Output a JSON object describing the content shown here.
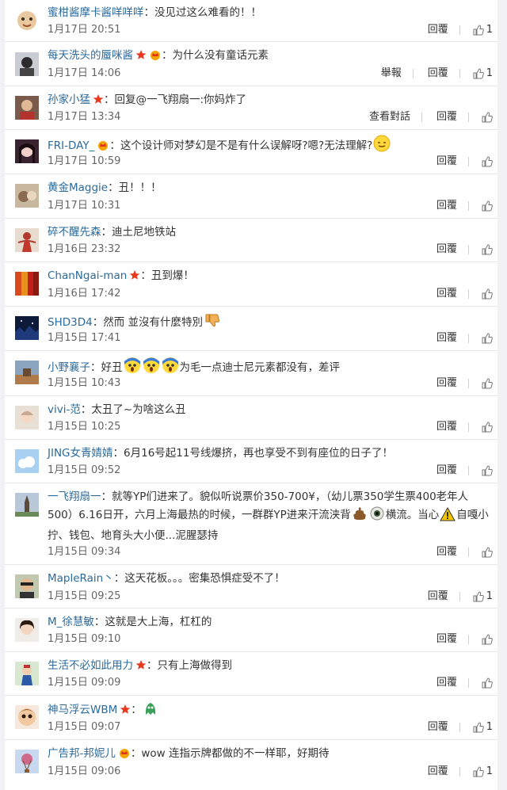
{
  "comments": [
    {
      "user": "蜜柑酱摩卡酱咩咩咩",
      "badges": [],
      "text": "没见过这么难看的！！",
      "time": "1月17日 20:51",
      "actions": [
        "回覆"
      ],
      "likes": "1"
    },
    {
      "user": "每天洗头的蜃咪酱",
      "badges": [
        "star-badge",
        "crown-badge"
      ],
      "text": "为什么没有童话元素",
      "time": "1月17日 14:06",
      "actions": [
        "舉報",
        "回覆"
      ],
      "likes": "1"
    },
    {
      "user": "孙家小猛",
      "badges": [
        "star-badge"
      ],
      "text": "回复@一飞翔扇一:你妈炸了",
      "time": "1月17日 13:34",
      "actions": [
        "查看對話",
        "回覆"
      ],
      "likes": ""
    },
    {
      "user": "FRI-DAY_",
      "badges": [
        "crown-badge"
      ],
      "text": "这个设计师对梦幻是不是有什么误解呀?嗯?无法理解?",
      "time": "1月17日 10:59",
      "actions": [
        "回覆"
      ],
      "likes": ""
    },
    {
      "user": "黄金Maggie",
      "badges": [],
      "text": "丑！！！",
      "time": "1月17日 10:31",
      "actions": [
        "回覆"
      ],
      "likes": ""
    },
    {
      "user": "碎不醒先森",
      "badges": [],
      "text": "迪土尼地铁站",
      "time": "1月16日 23:32",
      "actions": [
        "回覆"
      ],
      "likes": ""
    },
    {
      "user": "ChanNgai-man",
      "badges": [
        "star-badge"
      ],
      "text": "丑到爆！",
      "time": "1月16日 17:42",
      "actions": [
        "回覆"
      ],
      "likes": ""
    },
    {
      "user": "SHD3D4",
      "badges": [],
      "text": "然而 並沒有什麼特別",
      "time": "1月15日 17:41",
      "actions": [
        "回覆"
      ],
      "likes": ""
    },
    {
      "user": "小野襄子",
      "badges": [],
      "text": "好丑",
      "text2": "为毛一点迪士尼元素都没有，差评",
      "time": "1月15日 10:43",
      "actions": [
        "回覆"
      ],
      "likes": ""
    },
    {
      "user": "vivi-范",
      "badges": [],
      "text": "太丑了~为啥这么丑",
      "time": "1月15日 10:25",
      "actions": [
        "回覆"
      ],
      "likes": ""
    },
    {
      "user": "JING女青婧婧",
      "badges": [],
      "text": "6月16号起11号线爆挤，再也享受不到有座位的日子了！",
      "time": "1月15日 09:52",
      "actions": [
        "回覆"
      ],
      "likes": ""
    },
    {
      "user": "一飞翔扇一",
      "badges": [],
      "text": "就等YP们进来了。貌似听说票价350-700¥，（幼儿票350学生票400老年人500）6.16日开，六月上海最热的时候，一群群YP进来汗流浃背",
      "text2": "横流。当心",
      "text3": "自嘎小拧、钱包、地育头大小便...泥腥瑟持",
      "time": "1月15日 09:34",
      "actions": [
        "回覆"
      ],
      "likes": ""
    },
    {
      "user": "MapleRain丶",
      "badges": [],
      "text": "这天花板。。。密集恐惧症受不了！",
      "time": "1月15日 09:25",
      "actions": [
        "回覆"
      ],
      "likes": "1"
    },
    {
      "user": "M_徐慧敏",
      "badges": [],
      "text": "这就是大上海，杠杠的",
      "time": "1月15日 09:10",
      "actions": [
        "回覆"
      ],
      "likes": ""
    },
    {
      "user": "生活不必如此用力",
      "badges": [
        "star-badge"
      ],
      "text": "只有上海做得到",
      "time": "1月15日 09:09",
      "actions": [
        "回覆"
      ],
      "likes": ""
    },
    {
      "user": "神马浮云WBM",
      "badges": [
        "star-badge"
      ],
      "text": "",
      "time": "1月15日 09:07",
      "actions": [
        "回覆"
      ],
      "likes": "1"
    },
    {
      "user": "广告邦-邦妮儿",
      "badges": [
        "crown-badge"
      ],
      "text": "wow  连指示牌都做的不一样耶，好期待",
      "time": "1月15日 09:06",
      "actions": [
        "回覆"
      ],
      "likes": "1"
    }
  ],
  "icons": {
    "like": "thumbs-up-icon",
    "star": "star-badge",
    "crown": "crown-badge"
  },
  "colors": {
    "username": "#2b6a9b",
    "text": "#333333",
    "meta": "#666666",
    "divider": "#e6e6e6",
    "star": "#e8381e",
    "crown": "#f5a300"
  }
}
